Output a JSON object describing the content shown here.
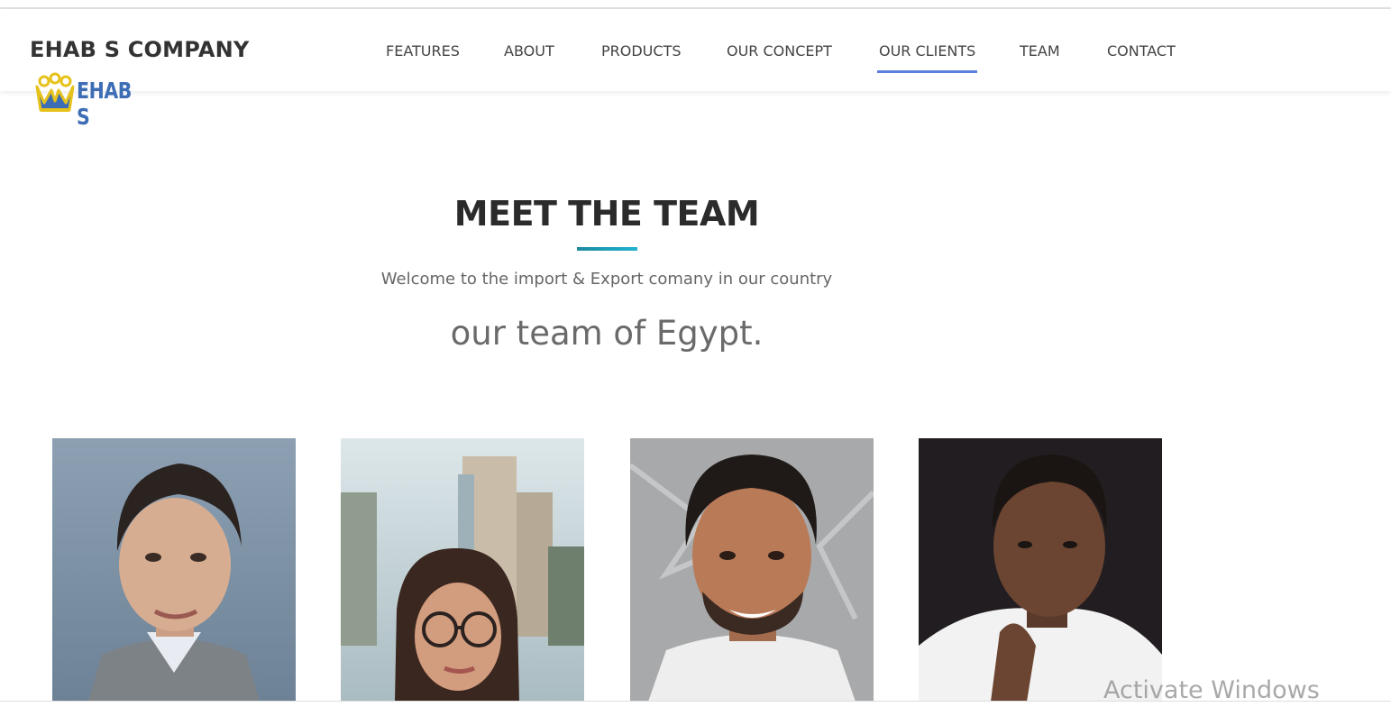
{
  "header": {
    "brand": "EHAB S COMPANY",
    "logo_text": "EHAB S"
  },
  "nav": {
    "items": [
      {
        "label": "FEATURES"
      },
      {
        "label": "ABOUT"
      },
      {
        "label": "PRODUCTS"
      },
      {
        "label": "OUR CONCEPT"
      },
      {
        "label": "OUR CLIENTS",
        "active": true
      },
      {
        "label": "TEAM"
      },
      {
        "label": "CONTACT"
      }
    ],
    "active_color": "#5b7fe0"
  },
  "section": {
    "title": "MEET THE TEAM",
    "subtitle": "Welcome to the import & Export comany in our country",
    "tagline": "our team of Egypt.",
    "accent_color": "#1fb3d0"
  },
  "team": {
    "photos": [
      {
        "name": "team-photo-1"
      },
      {
        "name": "team-photo-2"
      },
      {
        "name": "team-photo-3"
      },
      {
        "name": "team-photo-4"
      }
    ]
  },
  "system": {
    "watermark": "Activate Windows"
  }
}
